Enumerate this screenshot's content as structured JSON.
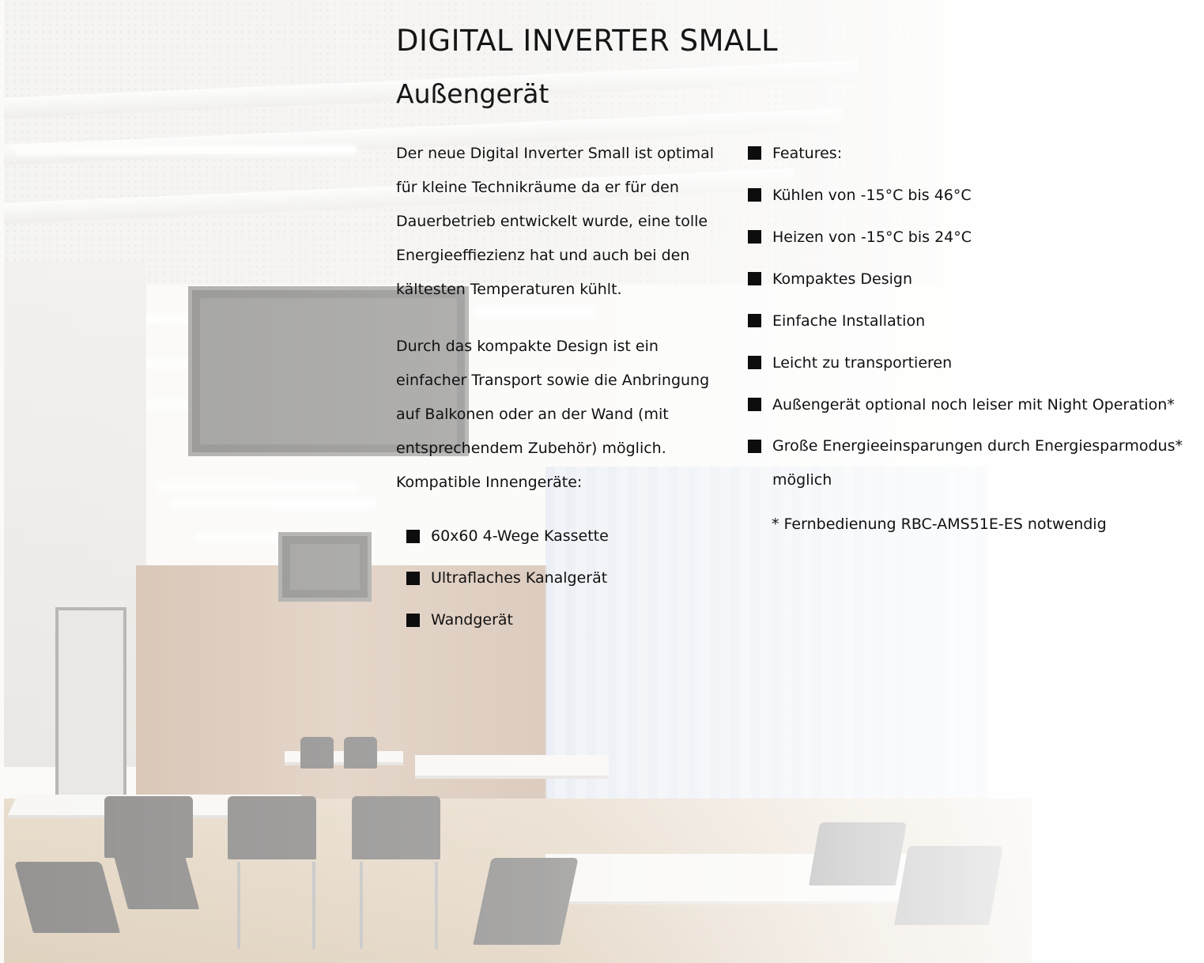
{
  "header": {
    "title": "DIGITAL INVERTER SMALL",
    "subtitle": "Außengerät"
  },
  "description": {
    "paragraph_1": "Der neue Digital Inverter Small ist optimal für kleine Technikräume da er für den Dauerbetrieb entwickelt wurde, eine tolle Energieeffiezienz hat und auch bei den kältesten Temperaturen kühlt.",
    "paragraph_1_lines": [
      "Der neue Digital Inverter Small ist optimal",
      "für kleine Technikräume da er für den",
      "Dauerbetrieb entwickelt wurde, eine tolle",
      "Energieeffiezienz hat und auch bei den",
      "kältesten Temperaturen kühlt."
    ],
    "paragraph_2_lines": [
      "Durch das kompakte Design ist ein",
      "einfacher Transport sowie die Anbringung",
      "auf Balkonen oder an der Wand (mit",
      "entsprechendem Zubehör) möglich."
    ],
    "compatible_label": "Kompatible Innengeräte:",
    "compatible_units": [
      "60x60 4-Wege Kassette",
      "Ultraflaches Kanalgerät",
      "Wandgerät"
    ]
  },
  "features": {
    "items": [
      "Features:",
      "Kühlen von -15°C bis 46°C",
      "Heizen von -15°C bis 24°C",
      "Kompaktes Design",
      "Einfache Installation",
      "Leicht zu transportieren",
      "Außengerät optional noch leiser mit Night Operation*"
    ],
    "multiline_item_lines": [
      "Große Energieeinsparungen durch Energiesparmodus*",
      "möglich"
    ],
    "footnote": "* Fernbedienung RBC-AMS51E-ES notwendig"
  },
  "icons": {
    "bullet": "square-bullet-icon"
  },
  "colors": {
    "text": "#111111",
    "bullet": "#0d0d0d",
    "background": "#f7f6f3"
  }
}
